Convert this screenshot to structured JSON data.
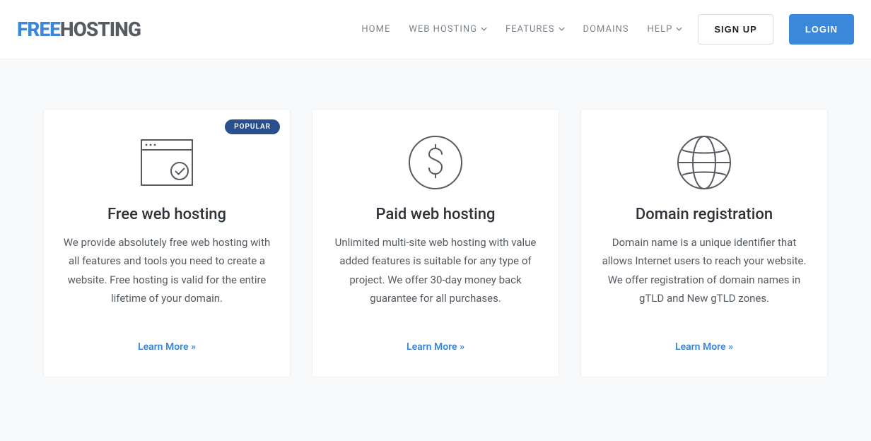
{
  "brand": {
    "part1": "FREE",
    "part2": "HOSTING"
  },
  "nav": {
    "home": "HOME",
    "web_hosting": "WEB HOSTING",
    "features": "FEATURES",
    "domains": "DOMAINS",
    "help": "HELP"
  },
  "actions": {
    "signup": "SIGN UP",
    "login": "LOGIN"
  },
  "cards": [
    {
      "badge": "POPULAR",
      "title": "Free web hosting",
      "desc": "We provide absolutely free web hosting with all features and tools you need to create a website. Free hosting is valid for the entire lifetime of your domain.",
      "cta": "Learn More »"
    },
    {
      "title": "Paid web hosting",
      "desc": "Unlimited multi-site web hosting with value added features is suitable for any type of project. We offer 30-day money back guarantee for all purchases.",
      "cta": "Learn More »"
    },
    {
      "title": "Domain registration",
      "desc": "Domain name is a unique identifier that allows Internet users to reach your website. We offer registration of domain names in gTLD and New gTLD zones.",
      "cta": "Learn More »"
    }
  ]
}
